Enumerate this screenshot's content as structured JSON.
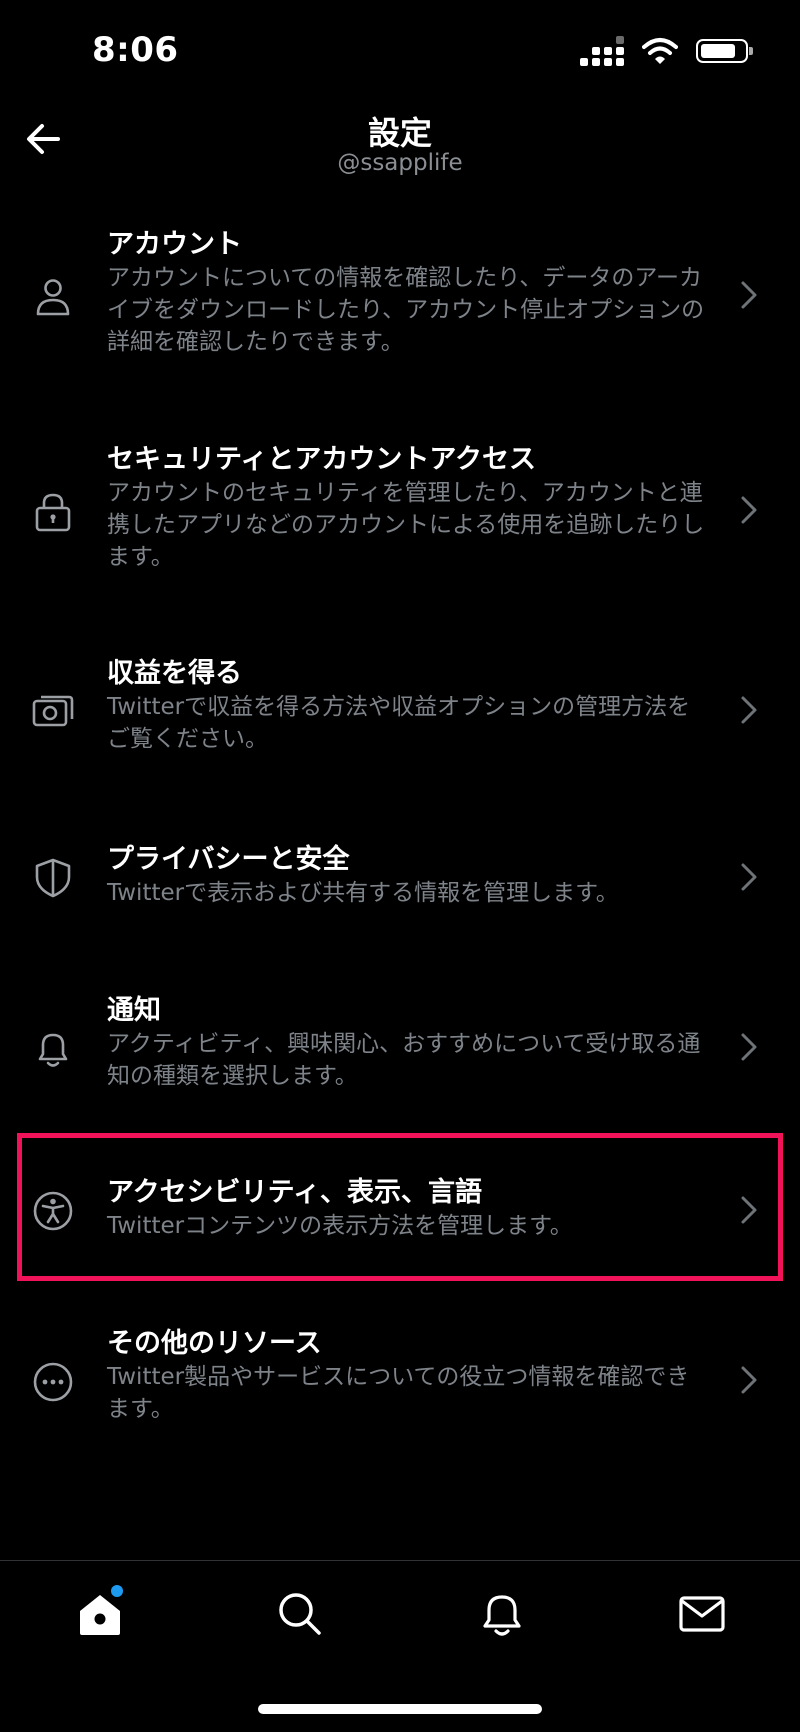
{
  "status_bar": {
    "time": "8:06"
  },
  "header": {
    "title": "設定",
    "handle": "@ssapplife"
  },
  "settings": [
    {
      "label": "アカウント",
      "description": "アカウントについての情報を確認したり、データのアーカイブをダウンロードしたり、アカウント停止オプションの詳細を確認したりできます。",
      "icon": "person-icon"
    },
    {
      "label": "セキュリティとアカウントアクセス",
      "description": "アカウントのセキュリティを管理したり、アカウントと連携したアプリなどのアカウントによる使用を追跡したりします。",
      "icon": "lock-icon"
    },
    {
      "label": "収益を得る",
      "description": "Twitterで収益を得る方法や収益オプションの管理方法をご覧ください。",
      "icon": "money-icon"
    },
    {
      "label": "プライバシーと安全",
      "description": "Twitterで表示および共有する情報を管理します。",
      "icon": "shield-icon"
    },
    {
      "label": "通知",
      "description": "アクティビティ、興味関心、おすすめについて受け取る通知の種類を選択します。",
      "icon": "bell-icon"
    },
    {
      "label": "アクセシビリティ、表示、言語",
      "description": "Twitterコンテンツの表示方法を管理します。",
      "icon": "accessibility-icon",
      "highlighted": true
    },
    {
      "label": "その他のリソース",
      "description": "Twitter製品やサービスについての役立つ情報を確認できます。",
      "icon": "more-icon"
    }
  ],
  "bottom_nav": [
    "home-icon",
    "search-icon",
    "bell-icon",
    "mail-icon"
  ],
  "colors": {
    "highlight": "#f0135a",
    "notification_dot": "#1d9bf0",
    "description": "#7e838a"
  }
}
